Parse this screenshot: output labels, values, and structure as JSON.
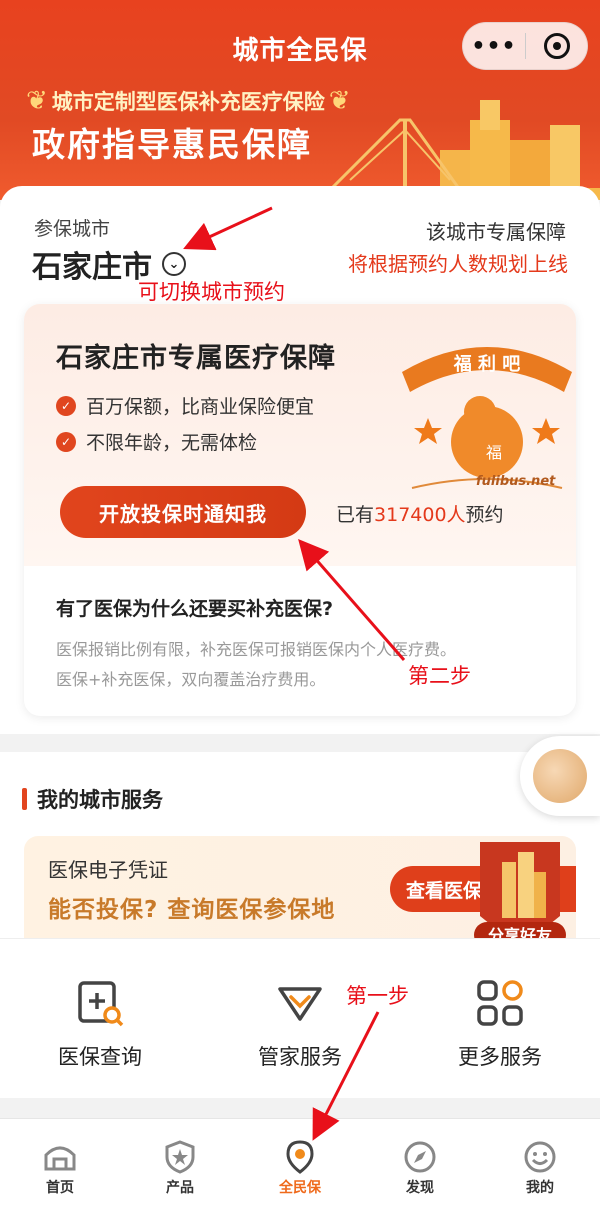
{
  "header": {
    "title": "城市全民保",
    "more_glyph": "•••",
    "banner_sub": "城市定制型医保补充医疗保险",
    "banner_main": "政府指导惠民保障"
  },
  "city": {
    "label": "参保城市",
    "name": "石家庄市",
    "exclusive_title": "该城市专属保障",
    "exclusive_note": "将根据预约人数规划上线"
  },
  "promo": {
    "title": "石家庄市专属医疗保障",
    "features": [
      "百万保额，比商业保险便宜",
      "不限年龄，无需体检"
    ],
    "notify_button": "开放投保时通知我",
    "reserve_prefix": "已有",
    "reserve_count": "317400人",
    "reserve_suffix": "预约",
    "why_title": "有了医保为什么还要买补充医保?",
    "why_lines": [
      "医保报销比例有限，补充医保可报销医保内个人医疗费。",
      "医保+补充医保，双向覆盖治疗费用。"
    ]
  },
  "watermark": {
    "banner": "福 利 吧",
    "char": "福",
    "url": "fulibus.net"
  },
  "services": {
    "header": "我的城市服务",
    "card_title": "医保电子凭证",
    "card_sub": "能否投保? 查询医保参保地",
    "card_button": "查看医保",
    "share_label": "分享好友"
  },
  "quick_entries": [
    {
      "label": "医保查询",
      "icon": "insurance-search-icon"
    },
    {
      "label": "管家服务",
      "icon": "butler-service-icon"
    },
    {
      "label": "更多服务",
      "icon": "more-services-icon"
    }
  ],
  "tabs": [
    {
      "label": "首页",
      "icon": "home-icon",
      "active": false
    },
    {
      "label": "产品",
      "icon": "product-shield-icon",
      "active": false
    },
    {
      "label": "全民保",
      "icon": "location-pin-icon",
      "active": true
    },
    {
      "label": "发现",
      "icon": "compass-icon",
      "active": false
    },
    {
      "label": "我的",
      "icon": "smile-icon",
      "active": false
    }
  ],
  "annotations": {
    "switch_city": "可切换城市预约",
    "step_two": "第二步",
    "step_one": "第一步"
  },
  "colors": {
    "primary_red": "#e1451d",
    "annotation_red": "#e8101a",
    "active_tab": "#ef6a1c",
    "gold_text": "#c87a2a"
  }
}
